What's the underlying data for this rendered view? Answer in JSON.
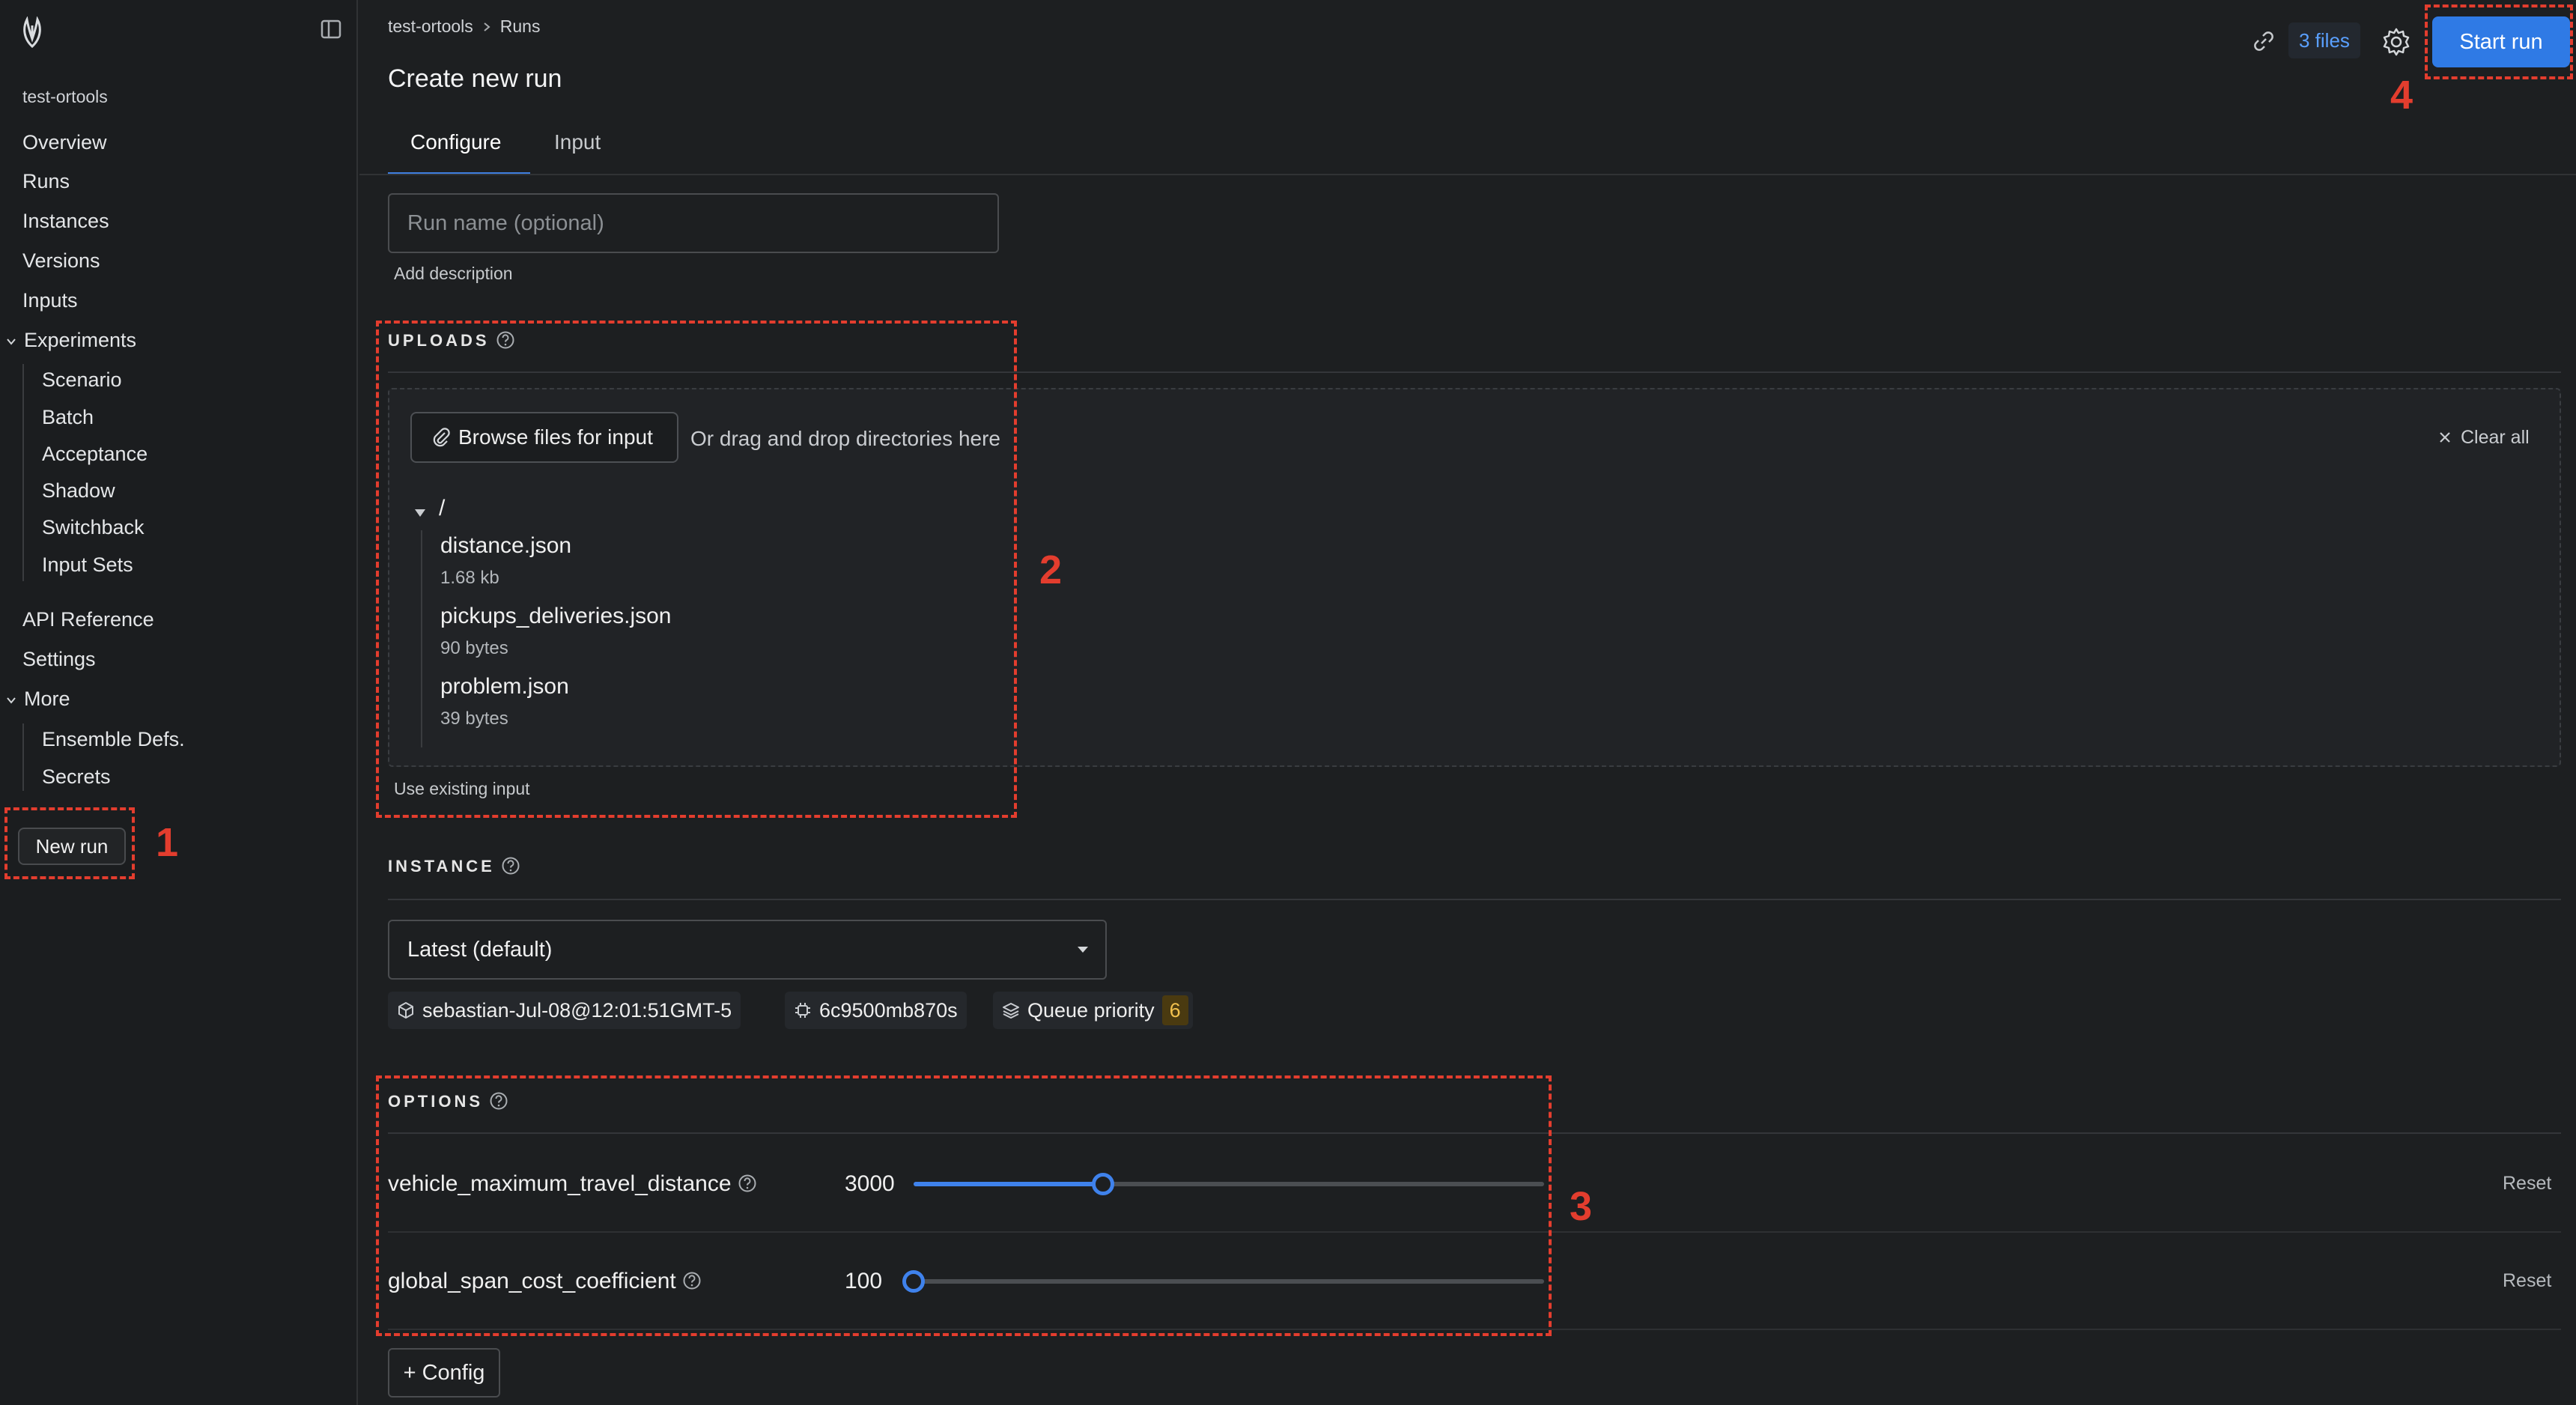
{
  "sidebar": {
    "project": "test-ortools",
    "items": {
      "overview": "Overview",
      "runs": "Runs",
      "instances": "Instances",
      "versions": "Versions",
      "inputs": "Inputs",
      "experiments": "Experiments",
      "scenario": "Scenario",
      "batch": "Batch",
      "acceptance": "Acceptance",
      "shadow": "Shadow",
      "switchback": "Switchback",
      "input_sets": "Input Sets",
      "api_reference": "API Reference",
      "settings": "Settings",
      "more": "More",
      "ensemble_defs": "Ensemble Defs.",
      "secrets": "Secrets"
    },
    "new_run": "New run"
  },
  "header": {
    "breadcrumb": [
      "test-ortools",
      "Runs"
    ],
    "title": "Create new run",
    "files_badge": "3 files",
    "start_run": "Start run"
  },
  "tabs": [
    "Configure",
    "Input"
  ],
  "form": {
    "run_name_placeholder": "Run name (optional)",
    "add_description": "Add description"
  },
  "uploads": {
    "label": "UPLOADS",
    "browse": "Browse files for input",
    "drag_text": "Or drag and drop directories here",
    "clear_all": "Clear all",
    "root": "/",
    "files": [
      {
        "name": "distance.json",
        "size": "1.68 kb"
      },
      {
        "name": "pickups_deliveries.json",
        "size": "90 bytes"
      },
      {
        "name": "problem.json",
        "size": "39 bytes"
      }
    ],
    "use_existing": "Use existing input"
  },
  "instance": {
    "label": "INSTANCE",
    "selected": "Latest (default)",
    "version_tag": "sebastian-Jul-08@12:01:51GMT-5",
    "machine_tag": "6c9500mb870s",
    "queue_label": "Queue priority",
    "queue_value": "6"
  },
  "options": {
    "label": "OPTIONS",
    "items": [
      {
        "name": "vehicle_maximum_travel_distance",
        "value": "3000",
        "fraction": 0.3,
        "reset": "Reset"
      },
      {
        "name": "global_span_cost_coefficient",
        "value": "100",
        "fraction": 0.0,
        "reset": "Reset"
      }
    ],
    "add_config": "+ Config"
  },
  "annotations": [
    "1",
    "2",
    "3",
    "4"
  ],
  "colors": {
    "accent": "#2f7ae5",
    "annotation": "#e33d2e",
    "background": "#1d1f21"
  }
}
